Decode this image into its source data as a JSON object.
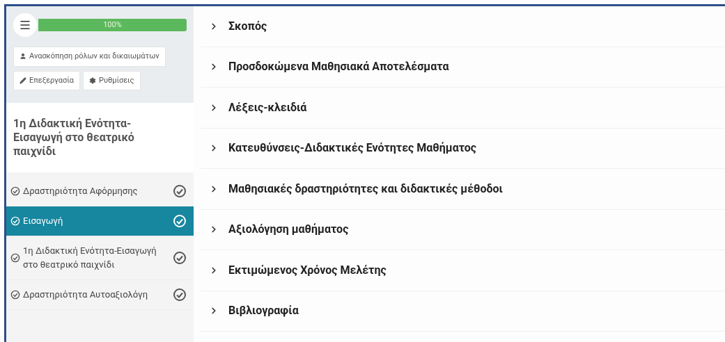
{
  "progress": {
    "label": "100%",
    "level": 1
  },
  "buttons": [
    {
      "kind": "user",
      "label": "Ανασκόπηση ρόλων και δικαιωμάτων"
    },
    {
      "kind": "pencil",
      "label": "Επεξεργασία"
    },
    {
      "kind": "gear",
      "label": "Ρυθμίσεις"
    }
  ],
  "section_title": "1η Διδακτική Ενότητα-Εισαγωγή στο θεατρικό παιχνίδι",
  "items": [
    {
      "label": "Δραστηριότητα Αφόρμησης",
      "selected": false,
      "completed": true
    },
    {
      "label": "Εισαγωγή",
      "selected": true,
      "completed": true
    },
    {
      "label": "1η Διδακτική Ενότητα-Εισαγωγή στο θεατρικό παιχνίδι",
      "selected": false,
      "completed": true
    },
    {
      "label": "Δραστηριότητα Αυτοαξιολόγη",
      "selected": false,
      "completed": true
    }
  ],
  "sections": [
    {
      "label": "Σκοπός",
      "expanded": false
    },
    {
      "label": "Προσδοκώμενα Μαθησιακά Αποτελέσματα",
      "expanded": false
    },
    {
      "label": "Λέξεις-κλειδιά",
      "expanded": false
    },
    {
      "label": "Κατευθύνσεις-Διδακτικές Ενότητες Μαθήματος",
      "expanded": false
    },
    {
      "label": "Μαθησιακές δραστηριότητες και διδακτικές μέθοδοι",
      "expanded": false
    },
    {
      "label": "Αξιολόγηση μαθήματος",
      "expanded": false
    },
    {
      "label": "Εκτιμώμενος Χρόνος Μελέτης",
      "expanded": false
    },
    {
      "label": "Βιβλιογραφία",
      "expanded": false
    }
  ]
}
